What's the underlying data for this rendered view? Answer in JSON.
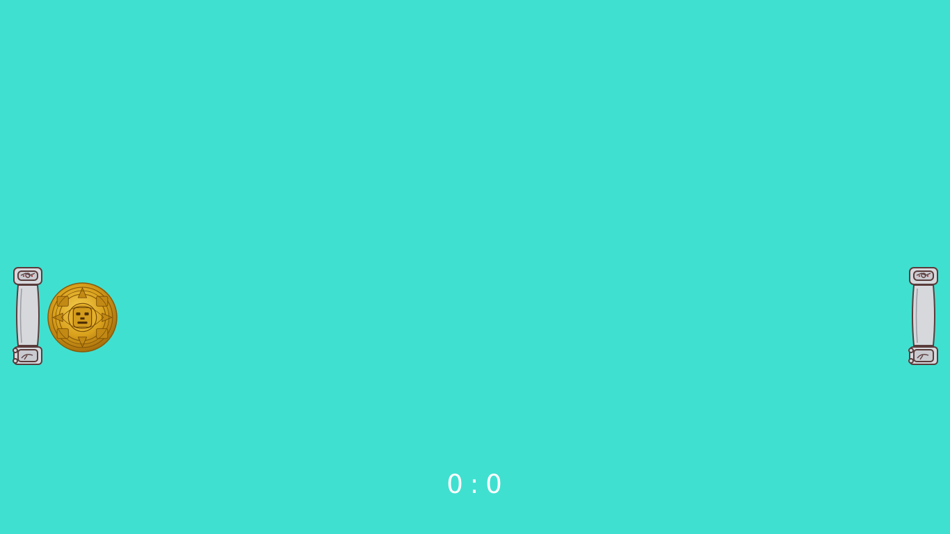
{
  "game": {
    "background_color": "#40e0d0",
    "score": {
      "left": "0",
      "separator": ":",
      "right": "0"
    },
    "paddles": [
      {
        "side": "left",
        "icon": "stone-pillar-icon"
      },
      {
        "side": "right",
        "icon": "stone-pillar-icon"
      }
    ],
    "ball": {
      "icon": "mayan-calendar-disc-icon",
      "color": "#d9a11c"
    }
  }
}
